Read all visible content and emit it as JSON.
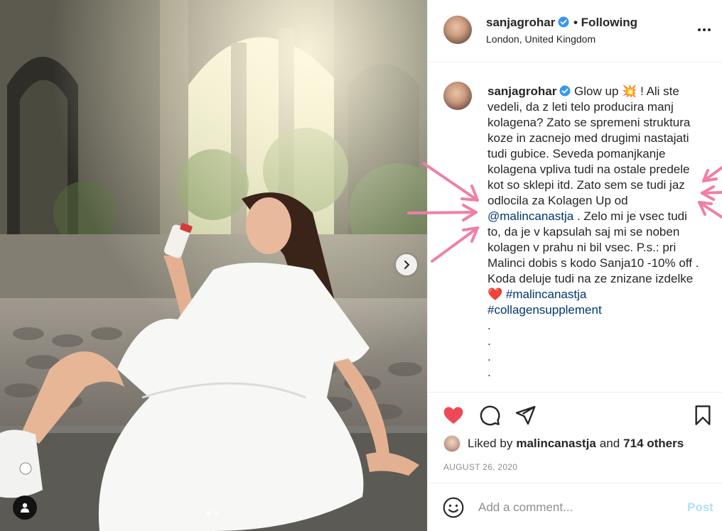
{
  "post": {
    "carousel_total": 2,
    "carousel_index": 1
  },
  "header": {
    "username": "sanjagrohar",
    "following_label": "• Following",
    "location": "London, United Kingdom"
  },
  "caption": {
    "username": "sanjagrohar",
    "text_1": "Glow up",
    "emoji_1": "💥",
    "text_2": "! Ali ste vedeli, da z leti telo producira manj kolagena? Zato se spremeni struktura koze in zacnejo med drugimi nastajati tudi gubice. Seveda pomanjkanje kolagena vpliva tudi na ostale predele kot so sklepi itd. Zato sem se tudi jaz odlocila za Kolagen Up od",
    "mention": "@malincanastja",
    "text_3": ". Zelo mi je vsec tudi to, da je v kapsulah saj mi se noben kolagen v prahu ni bil vsec. P.s.: pri Malinci dobis s kodo Sanja10 -10% off . Koda deluje tudi na ze znizane izdelke",
    "emoji_2": "❤️",
    "hashtag_1": "#malincanastja",
    "hashtag_2": "#collagensupplement",
    "trailing_dots": [
      ".",
      ".",
      ".",
      "."
    ]
  },
  "likes": {
    "prefix": "Liked by",
    "user": "malincanastja",
    "joiner": "and",
    "others": "714 others"
  },
  "date": "AUGUST 26, 2020",
  "comment_box": {
    "placeholder": "Add a comment...",
    "post_label": "Post"
  },
  "icons": {
    "verified": "verified-badge-icon",
    "more": "more-options-icon",
    "like": "heart-filled-icon",
    "comment": "comment-bubble-icon",
    "share": "paper-plane-icon",
    "save": "bookmark-icon",
    "emoji": "smiley-icon",
    "next": "chevron-right-icon",
    "tags": "user-tag-icon"
  },
  "colors": {
    "like_red": "#ed4956",
    "link_blue": "#00376b",
    "verified_blue": "#3897f0",
    "post_disabled": "#b2dffc",
    "annotation_pink": "#f07fa8"
  }
}
